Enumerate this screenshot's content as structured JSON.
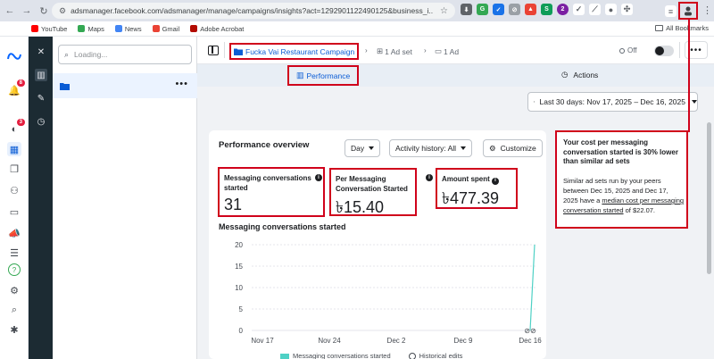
{
  "browser": {
    "url": "adsmanager.facebook.com/adsmanager/manage/campaigns/insights?act=1292901122490125&business_i...",
    "bookmarks": [
      "YouTube",
      "Maps",
      "News",
      "Gmail",
      "Adobe Acrobat"
    ],
    "all_bookmarks": "All Bookmarks",
    "extension_badge": "2"
  },
  "rail": {
    "badge_notifications": "8",
    "badge_campaigns": "3"
  },
  "panel": {
    "search_placeholder": "Loading...",
    "more": "•••"
  },
  "header": {
    "campaign": "Fucka Vai Restaurant Campaign",
    "ad_set": "1 Ad set",
    "ad": "1 Ad",
    "status": "Off",
    "more": "•••"
  },
  "tabs": {
    "performance": "Performance",
    "actions": "Actions"
  },
  "date_range": "Last 30 days: Nov 17, 2025 – Dec 16, 2025",
  "overview": {
    "title": "Performance overview",
    "day_label": "Day",
    "history_label": "Activity history: All",
    "customize_label": "Customize",
    "metrics": [
      {
        "label": "Messaging conversations started",
        "value": "31"
      },
      {
        "label": "Per Messaging Conversation Started",
        "value": "৳15.40"
      },
      {
        "label": "Amount spent",
        "value": "৳477.39"
      }
    ],
    "info_glyph": "i"
  },
  "chart_data": {
    "type": "line",
    "title": "Messaging conversations started",
    "x": [
      "Nov 17",
      "Nov 24",
      "Dec 2",
      "Dec 9",
      "Dec 16"
    ],
    "yticks": [
      0,
      5,
      10,
      15,
      20
    ],
    "ylim": [
      0,
      20
    ],
    "series": [
      {
        "name": "Messaging conversations started",
        "points": [
          [
            "Dec 16",
            0
          ],
          [
            "Dec 16",
            20
          ]
        ]
      }
    ],
    "legend": [
      "Messaging conversations started",
      "Historical edits"
    ],
    "color": "#4fd1c5"
  },
  "tip": {
    "headline": "Your cost per messaging conversation started is 30% lower than similar ad sets",
    "body_1": "Similar ad sets run by your peers between Dec 15, 2025 and Dec 17, 2025 have a",
    "body_link": "median cost per messaging conversation started",
    "body_2": "of $22.07."
  }
}
